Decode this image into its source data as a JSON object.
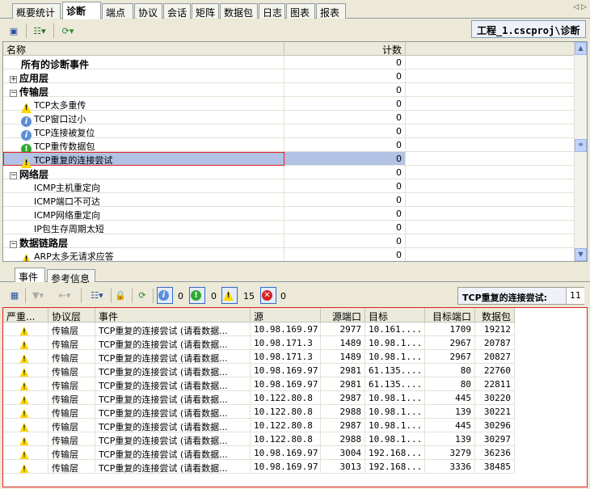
{
  "tabs": [
    "概要统计",
    "诊断",
    "端点",
    "协议",
    "会话",
    "矩阵",
    "数据包",
    "日志",
    "图表",
    "报表"
  ],
  "active_tab": 1,
  "path_label": "工程_1.cscproj\\诊断",
  "tree": {
    "headers": {
      "name": "名称",
      "count": "计数"
    },
    "rows": [
      {
        "label": "所有的诊断事件",
        "count": "0",
        "level": 0,
        "bold": true,
        "expander": "",
        "icon": ""
      },
      {
        "label": "应用层",
        "count": "0",
        "level": 0,
        "bold": true,
        "expander": "+",
        "icon": ""
      },
      {
        "label": "传输层",
        "count": "0",
        "level": 0,
        "bold": true,
        "expander": "-",
        "icon": ""
      },
      {
        "label": "TCP太多重传",
        "count": "0",
        "level": 1,
        "icon": "warning"
      },
      {
        "label": "TCP窗口过小",
        "count": "0",
        "level": 1,
        "icon": "info"
      },
      {
        "label": "TCP连接被复位",
        "count": "0",
        "level": 1,
        "icon": "info"
      },
      {
        "label": "TCP重传数据包",
        "count": "0",
        "level": 1,
        "icon": "notice"
      },
      {
        "label": "TCP重复的连接尝试",
        "count": "0",
        "level": 1,
        "icon": "warning",
        "selected": true
      },
      {
        "label": "网络层",
        "count": "0",
        "level": 0,
        "bold": true,
        "expander": "-",
        "icon": ""
      },
      {
        "label": "ICMP主机重定向",
        "count": "0",
        "level": 1,
        "icon": ""
      },
      {
        "label": "ICMP端口不可达",
        "count": "0",
        "level": 1,
        "icon": ""
      },
      {
        "label": "ICMP网络重定向",
        "count": "0",
        "level": 1,
        "icon": ""
      },
      {
        "label": "IP包生存周期太短",
        "count": "0",
        "level": 1,
        "icon": ""
      },
      {
        "label": "数据链路层",
        "count": "0",
        "level": 0,
        "bold": true,
        "expander": "-",
        "icon": ""
      },
      {
        "label": "ARP太多无请求应答",
        "count": "0",
        "level": 1,
        "icon": "warning"
      }
    ]
  },
  "bottom_tabs": [
    "事件",
    "参考信息"
  ],
  "filters": {
    "info": "0",
    "notice": "0",
    "warning": "15",
    "error": "0"
  },
  "event_label": "TCP重复的连接尝试:",
  "event_count": "11",
  "grid": {
    "headers": [
      "严重...",
      "协议层",
      "事件",
      "源",
      "源端口",
      "目标",
      "目标端口",
      "数据包"
    ],
    "rows": [
      [
        "传输层",
        "TCP重复的连接尝试 (请看数据...",
        "10.98.169.97",
        "2977",
        "10.161....",
        "1709",
        "19212"
      ],
      [
        "传输层",
        "TCP重复的连接尝试 (请看数据...",
        "10.98.171.3",
        "1489",
        "10.98.1...",
        "2967",
        "20787"
      ],
      [
        "传输层",
        "TCP重复的连接尝试 (请看数据...",
        "10.98.171.3",
        "1489",
        "10.98.1...",
        "2967",
        "20827"
      ],
      [
        "传输层",
        "TCP重复的连接尝试 (请看数据...",
        "10.98.169.97",
        "2981",
        "61.135....",
        "80",
        "22760"
      ],
      [
        "传输层",
        "TCP重复的连接尝试 (请看数据...",
        "10.98.169.97",
        "2981",
        "61.135....",
        "80",
        "22811"
      ],
      [
        "传输层",
        "TCP重复的连接尝试 (请看数据...",
        "10.122.80.8",
        "2987",
        "10.98.1...",
        "445",
        "30220"
      ],
      [
        "传输层",
        "TCP重复的连接尝试 (请看数据...",
        "10.122.80.8",
        "2988",
        "10.98.1...",
        "139",
        "30221"
      ],
      [
        "传输层",
        "TCP重复的连接尝试 (请看数据...",
        "10.122.80.8",
        "2987",
        "10.98.1...",
        "445",
        "30296"
      ],
      [
        "传输层",
        "TCP重复的连接尝试 (请看数据...",
        "10.122.80.8",
        "2988",
        "10.98.1...",
        "139",
        "30297"
      ],
      [
        "传输层",
        "TCP重复的连接尝试 (请看数据...",
        "10.98.169.97",
        "3004",
        "192.168...",
        "3279",
        "36236"
      ],
      [
        "传输层",
        "TCP重复的连接尝试 (请看数据...",
        "10.98.169.97",
        "3013",
        "192.168...",
        "3336",
        "38485"
      ]
    ]
  }
}
